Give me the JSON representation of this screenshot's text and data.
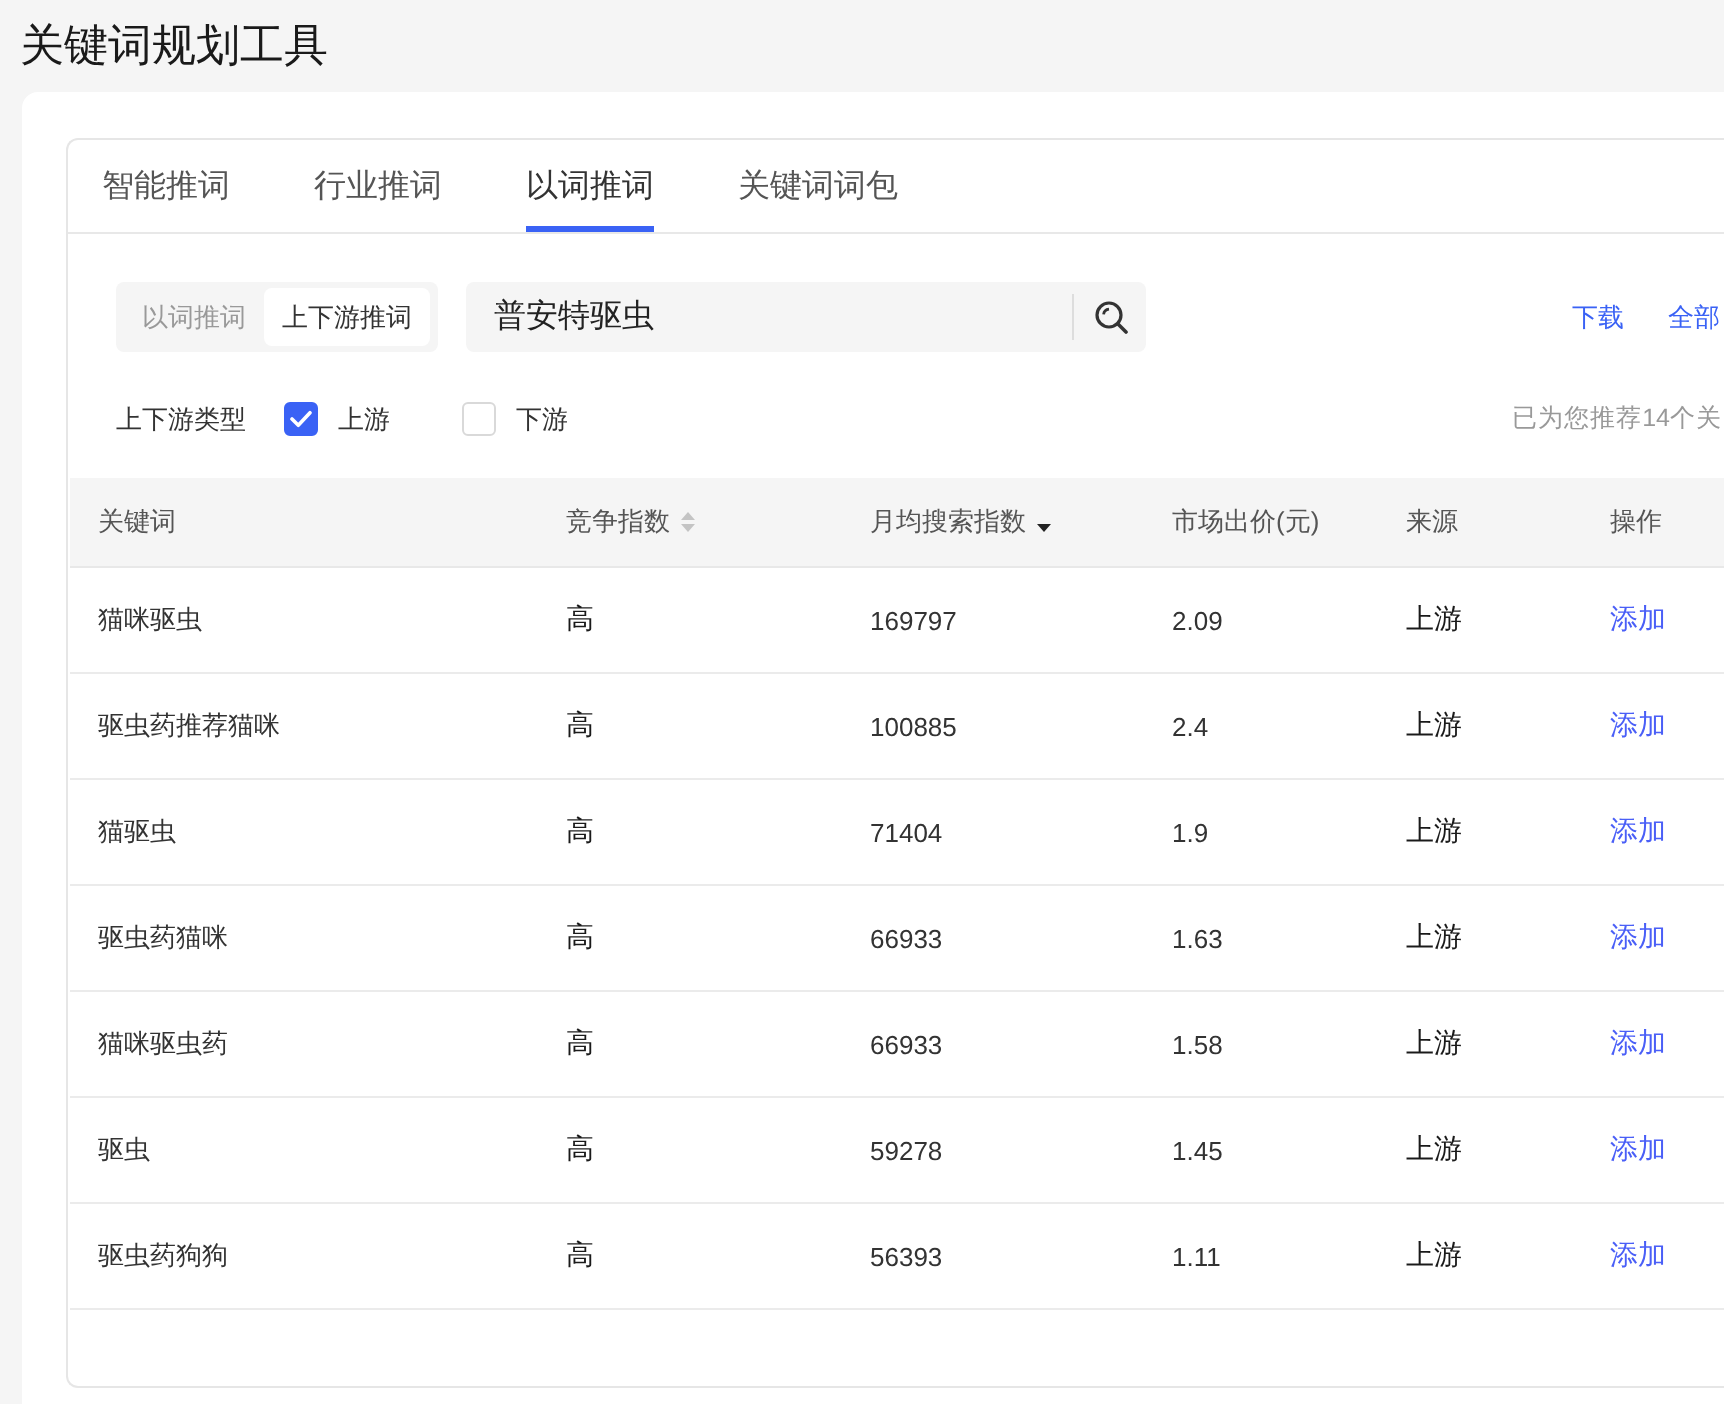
{
  "page": {
    "title": "关键词规划工具"
  },
  "tabs": [
    {
      "label": "智能推词",
      "selected": false
    },
    {
      "label": "行业推词",
      "selected": false
    },
    {
      "label": "以词推词",
      "selected": true
    },
    {
      "label": "关键词词包",
      "selected": false
    }
  ],
  "mode_switch": [
    {
      "label": "以词推词",
      "selected": false
    },
    {
      "label": "上下游推词",
      "selected": true
    }
  ],
  "search": {
    "value": "普安特驱虫"
  },
  "actions": [
    "下载",
    "全部"
  ],
  "filter": {
    "label": "上下游类型",
    "options": [
      {
        "label": "上游",
        "checked": true
      },
      {
        "label": "下游",
        "checked": false
      }
    ]
  },
  "summary": "已为您推荐14个关",
  "table": {
    "columns": [
      {
        "label": "关键词"
      },
      {
        "label": "竞争指数",
        "sorted": false
      },
      {
        "label": "月均搜索指数",
        "sorted": true
      },
      {
        "label": "市场出价(元)"
      },
      {
        "label": "来源"
      },
      {
        "label": "操作"
      }
    ],
    "rows": [
      {
        "keyword": "猫咪驱虫",
        "competition": "高",
        "monthly_searches": "169797",
        "bid": "2.09",
        "source": "上游",
        "action": "添加"
      },
      {
        "keyword": "驱虫药推荐猫咪",
        "competition": "高",
        "monthly_searches": "100885",
        "bid": "2.4",
        "source": "上游",
        "action": "添加"
      },
      {
        "keyword": "猫驱虫",
        "competition": "高",
        "monthly_searches": "71404",
        "bid": "1.9",
        "source": "上游",
        "action": "添加"
      },
      {
        "keyword": "驱虫药猫咪",
        "competition": "高",
        "monthly_searches": "66933",
        "bid": "1.63",
        "source": "上游",
        "action": "添加"
      },
      {
        "keyword": "猫咪驱虫药",
        "competition": "高",
        "monthly_searches": "66933",
        "bid": "1.58",
        "source": "上游",
        "action": "添加"
      },
      {
        "keyword": "驱虫",
        "competition": "高",
        "monthly_searches": "59278",
        "bid": "1.45",
        "source": "上游",
        "action": "添加"
      },
      {
        "keyword": "驱虫药狗狗",
        "competition": "高",
        "monthly_searches": "56393",
        "bid": "1.11",
        "source": "上游",
        "action": "添加"
      }
    ]
  }
}
